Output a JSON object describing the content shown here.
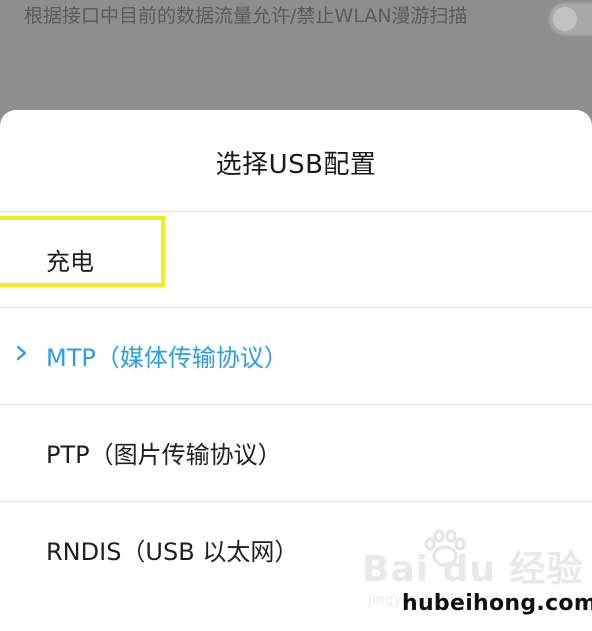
{
  "background": {
    "setting_text": "根据接口中目前的数据流量允许/禁止WLAN漫游扫描"
  },
  "dialog": {
    "title": "选择USB配置",
    "options": [
      {
        "label": "充电"
      },
      {
        "label": "MTP（媒体传输协议）",
        "selected": true
      },
      {
        "label": "PTP（图片传输协议）"
      },
      {
        "label": "RNDIS（USB 以太网）"
      }
    ]
  },
  "watermarks": {
    "baidu": "Bai du 经验",
    "baidu_sub": "jingyan.baidu.com",
    "site": "hubeihong.com"
  },
  "colors": {
    "accent": "#2a9ee8",
    "highlight": "#f2ec1a",
    "dim_overlay": "#8e8e8e"
  }
}
